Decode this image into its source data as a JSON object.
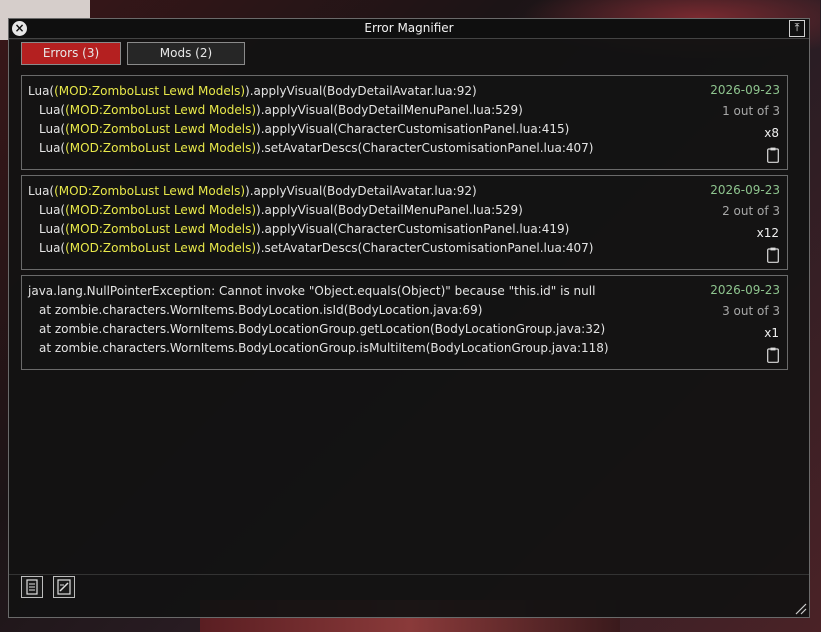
{
  "window": {
    "title": "Error Magnifier"
  },
  "titlebar": {
    "close_glyph": "×",
    "pin_glyph": "⤒"
  },
  "tabs": [
    {
      "label": "Errors (3)",
      "active": true
    },
    {
      "label": "Mods (2)",
      "active": false
    }
  ],
  "errors": [
    {
      "date": "2026-09-23",
      "position": "1 out of 3",
      "multiplier": "x8",
      "lines": [
        {
          "prefix": "Lua(",
          "mod": "(MOD:ZomboLust Lewd Models)",
          "suffix": ").applyVisual(BodyDetailAvatar.lua:92)"
        },
        {
          "prefix": "Lua(",
          "mod": "(MOD:ZomboLust Lewd Models)",
          "suffix": ").applyVisual(BodyDetailMenuPanel.lua:529)"
        },
        {
          "prefix": "Lua(",
          "mod": "(MOD:ZomboLust Lewd Models)",
          "suffix": ").applyVisual(CharacterCustomisationPanel.lua:415)"
        },
        {
          "prefix": "Lua(",
          "mod": "(MOD:ZomboLust Lewd Models)",
          "suffix": ").setAvatarDescs(CharacterCustomisationPanel.lua:407)"
        }
      ]
    },
    {
      "date": "2026-09-23",
      "position": "2 out of 3",
      "multiplier": "x12",
      "lines": [
        {
          "prefix": "Lua(",
          "mod": "(MOD:ZomboLust Lewd Models)",
          "suffix": ").applyVisual(BodyDetailAvatar.lua:92)"
        },
        {
          "prefix": "Lua(",
          "mod": "(MOD:ZomboLust Lewd Models)",
          "suffix": ").applyVisual(BodyDetailMenuPanel.lua:529)"
        },
        {
          "prefix": "Lua(",
          "mod": "(MOD:ZomboLust Lewd Models)",
          "suffix": ").applyVisual(CharacterCustomisationPanel.lua:419)"
        },
        {
          "prefix": "Lua(",
          "mod": "(MOD:ZomboLust Lewd Models)",
          "suffix": ").setAvatarDescs(CharacterCustomisationPanel.lua:407)"
        }
      ]
    },
    {
      "date": "2026-09-23",
      "position": "3 out of 3",
      "multiplier": "x1",
      "lines": [
        {
          "prefix": "java.lang.NullPointerException: Cannot invoke \"Object.equals(Object)\" because \"this.id\" is null",
          "mod": "",
          "suffix": ""
        },
        {
          "prefix": "at zombie.characters.WornItems.BodyLocation.isId(BodyLocation.java:69)",
          "mod": "",
          "suffix": ""
        },
        {
          "prefix": "at zombie.characters.WornItems.BodyLocationGroup.getLocation(BodyLocationGroup.java:32)",
          "mod": "",
          "suffix": ""
        },
        {
          "prefix": "at zombie.characters.WornItems.BodyLocationGroup.isMultiItem(BodyLocationGroup.java:118)",
          "mod": "",
          "suffix": ""
        }
      ]
    }
  ],
  "icons": {
    "copy": "clipboard-icon",
    "bottom_left_1": "notebook-icon",
    "bottom_left_2": "notepad-icon"
  },
  "colors": {
    "active_tab": "#b42020",
    "mod_highlight": "#e8e84a",
    "date": "#8ec48e"
  }
}
